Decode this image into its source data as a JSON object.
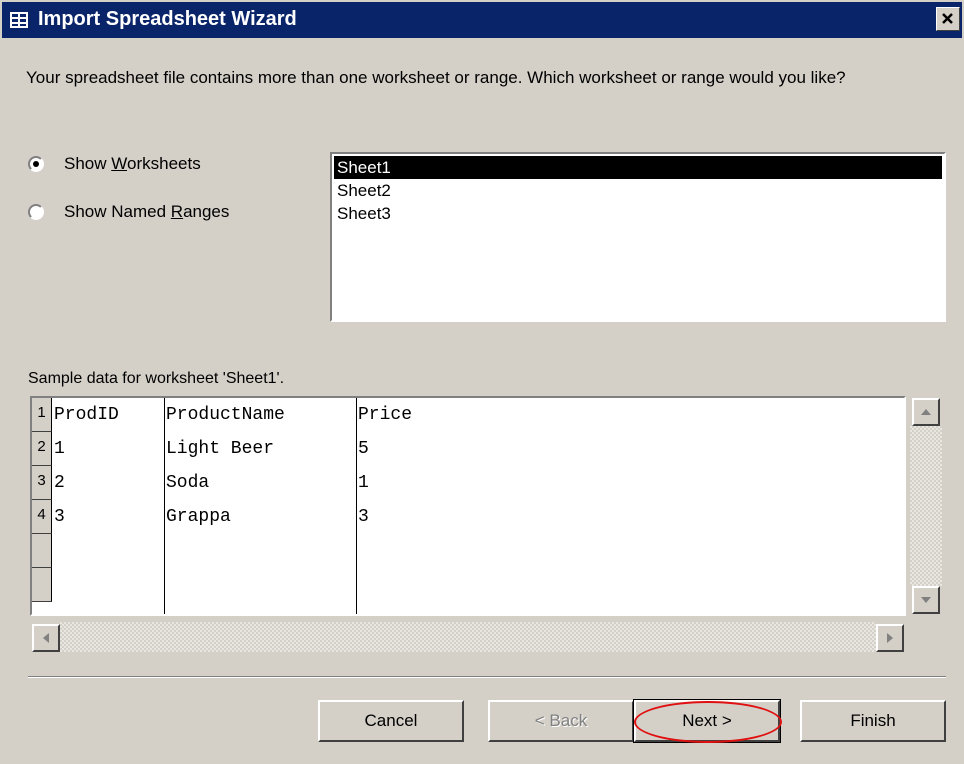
{
  "window": {
    "title": "Import Spreadsheet Wizard"
  },
  "prompt": "Your spreadsheet file contains more than one worksheet or range. Which worksheet or range would you like?",
  "options": {
    "show_worksheets": {
      "label": "Show Worksheets",
      "accel": "W",
      "selected": true
    },
    "show_named_ranges": {
      "label": "Show Named Ranges",
      "accel": "R",
      "selected": false
    }
  },
  "sheet_list": {
    "items": [
      "Sheet1",
      "Sheet2",
      "Sheet3"
    ],
    "selected": "Sheet1"
  },
  "sample": {
    "label": "Sample data for worksheet 'Sheet1'.",
    "row_numbers": [
      "1",
      "2",
      "3",
      "4",
      "",
      ""
    ],
    "columns": [
      "ProdID",
      "ProductName",
      "Price"
    ],
    "rows": [
      [
        "1",
        "Light Beer",
        "5"
      ],
      [
        "2",
        "Soda",
        "1"
      ],
      [
        "3",
        "Grappa",
        "3"
      ]
    ]
  },
  "buttons": {
    "cancel": "Cancel",
    "back": "< Back",
    "next": "Next >",
    "finish": "Finish"
  },
  "colors": {
    "titlebar": "#0a246a",
    "highlight": "#e01010",
    "face": "#d4d0c8"
  }
}
